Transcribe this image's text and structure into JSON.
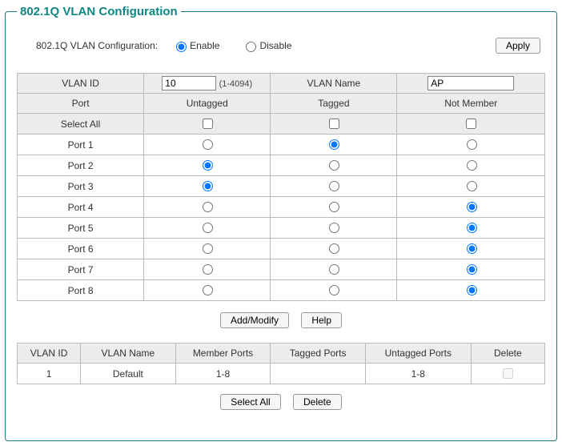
{
  "title": "802.1Q VLAN Configuration",
  "config": {
    "label": "802.1Q VLAN Configuration:",
    "enable_label": "Enable",
    "disable_label": "Disable",
    "state": "enable",
    "apply_label": "Apply"
  },
  "port_table": {
    "headers": {
      "vlan_id": "VLAN ID",
      "vlan_name": "VLAN Name",
      "port": "Port",
      "untagged": "Untagged",
      "tagged": "Tagged",
      "not_member": "Not Member",
      "select_all": "Select All"
    },
    "vlan_id_value": "10",
    "vlan_id_range": "(1-4094)",
    "vlan_name_value": "AP",
    "select_all": {
      "untagged": false,
      "tagged": false,
      "not_member": false
    },
    "ports": [
      {
        "name": "Port 1",
        "sel": "tagged"
      },
      {
        "name": "Port 2",
        "sel": "untagged"
      },
      {
        "name": "Port 3",
        "sel": "untagged"
      },
      {
        "name": "Port 4",
        "sel": "not_member"
      },
      {
        "name": "Port 5",
        "sel": "not_member"
      },
      {
        "name": "Port 6",
        "sel": "not_member"
      },
      {
        "name": "Port 7",
        "sel": "not_member"
      },
      {
        "name": "Port 8",
        "sel": "not_member"
      }
    ]
  },
  "buttons": {
    "add_modify": "Add/Modify",
    "help": "Help",
    "select_all": "Select All",
    "delete": "Delete"
  },
  "vlan_list": {
    "headers": {
      "vlan_id": "VLAN ID",
      "vlan_name": "VLAN Name",
      "member_ports": "Member Ports",
      "tagged_ports": "Tagged Ports",
      "untagged_ports": "Untagged Ports",
      "delete": "Delete"
    },
    "rows": [
      {
        "id": "1",
        "name": "Default",
        "member": "1-8",
        "tagged": "",
        "untagged": "1-8",
        "del_disabled": true
      }
    ]
  }
}
